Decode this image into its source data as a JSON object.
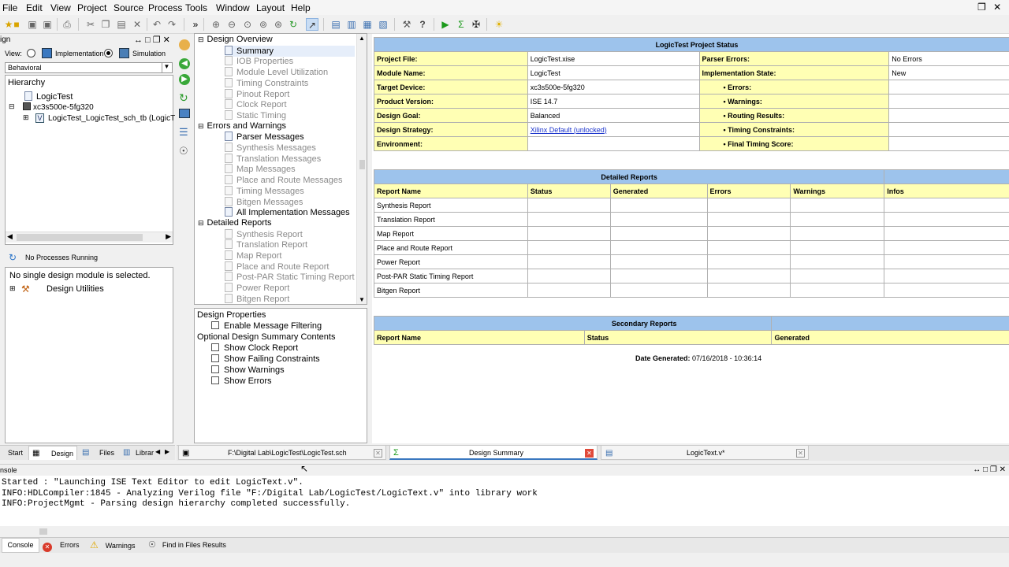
{
  "menu": [
    "File",
    "Edit",
    "View",
    "Project",
    "Source",
    "Process",
    "Tools",
    "Window",
    "Layout",
    "Help"
  ],
  "design_panel": {
    "title": "ign",
    "view_label": "View:",
    "view_implementation": "Implementation",
    "view_simulation": "Simulation",
    "behavior_select": "Behavioral",
    "hierarchy_label": "Hierarchy",
    "tree": [
      "LogicTest",
      "xc3s500e-5fg320",
      "LogicTest_LogicTest_sch_tb (LogicT"
    ],
    "processes_status": "No Processes Running",
    "no_module": "No single design module is selected.",
    "design_utilities": "Design Utilities",
    "bottom_tabs": [
      "Start",
      "Design",
      "Files",
      "Librar"
    ]
  },
  "summary_tree": {
    "groups": [
      {
        "label": "Design Overview",
        "items": [
          {
            "label": "Summary",
            "active": true
          },
          {
            "label": "IOB Properties",
            "active": false
          },
          {
            "label": "Module Level Utilization",
            "active": false
          },
          {
            "label": "Timing Constraints",
            "active": false
          },
          {
            "label": "Pinout Report",
            "active": false
          },
          {
            "label": "Clock Report",
            "active": false
          },
          {
            "label": "Static Timing",
            "active": false
          }
        ]
      },
      {
        "label": "Errors and Warnings",
        "items": [
          {
            "label": "Parser Messages",
            "active": true
          },
          {
            "label": "Synthesis Messages",
            "active": false
          },
          {
            "label": "Translation Messages",
            "active": false
          },
          {
            "label": "Map Messages",
            "active": false
          },
          {
            "label": "Place and Route Messages",
            "active": false
          },
          {
            "label": "Timing Messages",
            "active": false
          },
          {
            "label": "Bitgen Messages",
            "active": false
          },
          {
            "label": "All Implementation Messages",
            "active": true
          }
        ]
      },
      {
        "label": "Detailed Reports",
        "items": [
          {
            "label": "Synthesis Report",
            "active": false
          },
          {
            "label": "Translation Report",
            "active": false
          },
          {
            "label": "Map Report",
            "active": false
          },
          {
            "label": "Place and Route Report",
            "active": false
          },
          {
            "label": "Post-PAR Static Timing Report",
            "active": false
          },
          {
            "label": "Power Report",
            "active": false
          },
          {
            "label": "Bitgen Report",
            "active": false
          }
        ]
      }
    ]
  },
  "design_properties": {
    "title": "Design Properties",
    "enable_filtering": "Enable Message Filtering",
    "optional_title": "Optional Design Summary Contents",
    "options": [
      "Show Clock Report",
      "Show Failing Constraints",
      "Show Warnings",
      "Show Errors"
    ]
  },
  "project_status": {
    "title": "LogicTest Project Status",
    "rows": [
      [
        "Project File:",
        "LogicTest.xise",
        "Parser Errors:",
        "No Errors"
      ],
      [
        "Module Name:",
        "LogicTest",
        "Implementation State:",
        "New"
      ],
      [
        "Target Device:",
        "xc3s500e-5fg320",
        "• Errors:",
        ""
      ],
      [
        "Product Version:",
        "ISE 14.7",
        "• Warnings:",
        ""
      ],
      [
        "Design Goal:",
        "Balanced",
        "• Routing Results:",
        ""
      ],
      [
        "Design Strategy:",
        "Xilinx Default (unlocked)",
        "• Timing Constraints:",
        ""
      ],
      [
        "Environment:",
        "",
        "• Final Timing Score:",
        ""
      ]
    ]
  },
  "detailed_reports": {
    "title": "Detailed Reports",
    "columns": [
      "Report Name",
      "Status",
      "Generated",
      "Errors",
      "Warnings",
      "Infos"
    ],
    "rows": [
      "Synthesis Report",
      "Translation Report",
      "Map Report",
      "Place and Route Report",
      "Power Report",
      "Post-PAR Static Timing Report",
      "Bitgen Report"
    ]
  },
  "secondary_reports": {
    "title": "Secondary Reports",
    "columns": [
      "Report Name",
      "Status",
      "Generated"
    ]
  },
  "date_generated": {
    "label": "Date Generated:",
    "value": "07/16/2018 - 10:36:14"
  },
  "doc_tabs": [
    "F:\\Digital Lab\\LogicTest\\LogicTest.sch",
    "Design Summary",
    "LogicText.v*"
  ],
  "console": {
    "title": "nsole",
    "lines": [
      "Started : \"Launching ISE Text Editor to edit LogicText.v\".",
      "INFO:HDLCompiler:1845 - Analyzing Verilog file \"F:/Digital Lab/LogicTest/LogicText.v\" into library work",
      "INFO:ProjectMgmt - Parsing design hierarchy completed successfully."
    ]
  },
  "bottom_tabs": [
    "Console",
    "Errors",
    "Warnings",
    "Find in Files Results"
  ]
}
